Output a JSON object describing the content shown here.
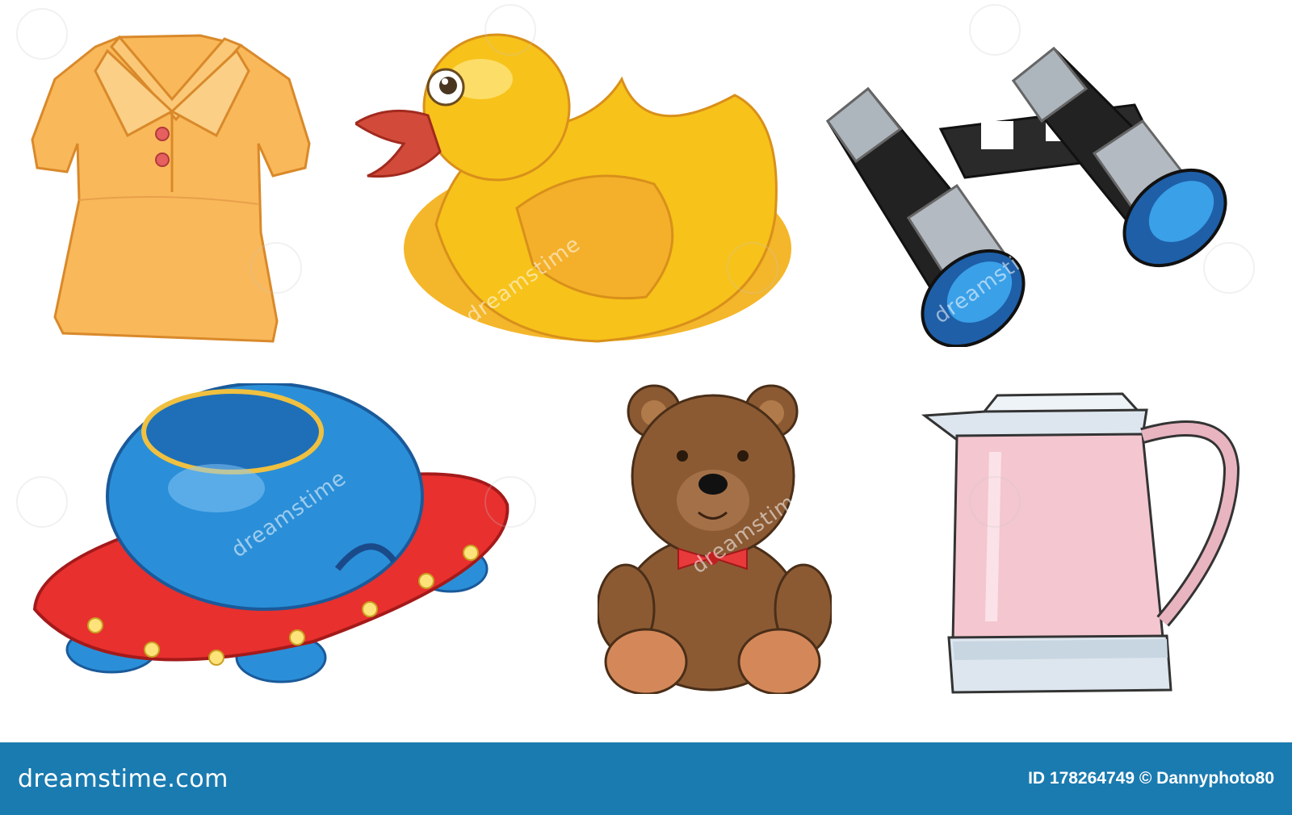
{
  "items": [
    {
      "name": "shirt"
    },
    {
      "name": "rubber-duck"
    },
    {
      "name": "binoculars"
    },
    {
      "name": "ufo-toy"
    },
    {
      "name": "teddy-bear"
    },
    {
      "name": "electric-kettle"
    }
  ],
  "watermark": {
    "text": "dreamstime"
  },
  "footer": {
    "logo": "dreamstime.com",
    "credit": "ID 178264749 © Dannyphoto80",
    "background": "#1a7bb0"
  },
  "colors": {
    "shirt": "#f9b85a",
    "duck": "#f7c21a",
    "kettle": "#f4c6d0",
    "ufo_dome": "#2a8fd8",
    "ufo_saucer": "#e8302e",
    "bear": "#8b5a33"
  }
}
